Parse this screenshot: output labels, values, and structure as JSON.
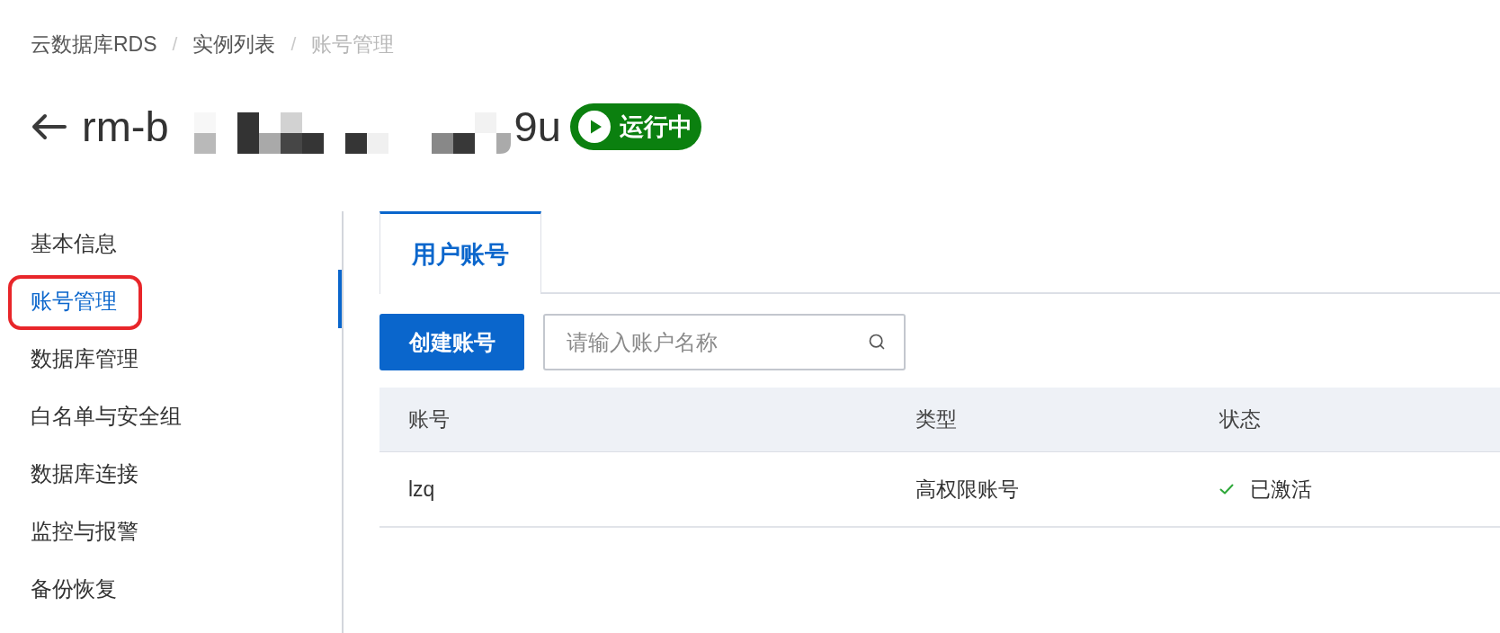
{
  "breadcrumb": [
    {
      "label": "云数据库RDS",
      "separator": "/",
      "current": false
    },
    {
      "label": "实例列表",
      "separator": "/",
      "current": false
    },
    {
      "label": "账号管理",
      "current": true
    }
  ],
  "page_title": {
    "visible_start": "rm-b",
    "visible_end": "9u",
    "redacted": true
  },
  "status_badge": {
    "label": "运行中",
    "kind": "running"
  },
  "sidebar": {
    "items": [
      {
        "label": "基本信息",
        "selected": false,
        "highlighted": false
      },
      {
        "label": "账号管理",
        "selected": true,
        "highlighted": true
      },
      {
        "label": "数据库管理",
        "selected": false,
        "highlighted": false
      },
      {
        "label": "白名单与安全组",
        "selected": false,
        "highlighted": false
      },
      {
        "label": "数据库连接",
        "selected": false,
        "highlighted": false
      },
      {
        "label": "监控与报警",
        "selected": false,
        "highlighted": false
      },
      {
        "label": "备份恢复",
        "selected": false,
        "highlighted": false
      }
    ]
  },
  "tabs": [
    {
      "label": "用户账号",
      "selected": true
    }
  ],
  "toolbar": {
    "create_button": "创建账号",
    "search": {
      "placeholder": "请输入账户名称"
    }
  },
  "table": {
    "columns": [
      "账号",
      "类型",
      "状态"
    ],
    "rows": [
      {
        "cells": [
          "lzq",
          "高权限账号",
          "已激活"
        ],
        "activated": true
      }
    ]
  }
}
